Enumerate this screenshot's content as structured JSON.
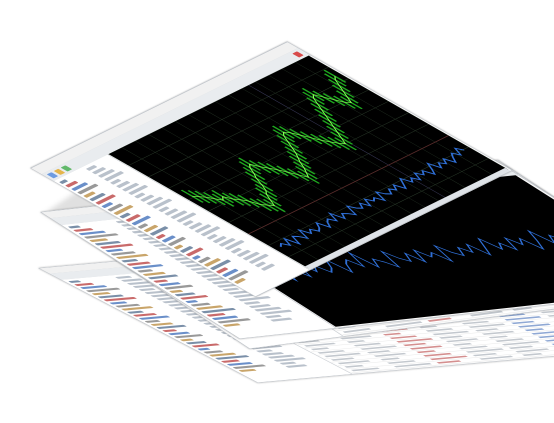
{
  "scene": {
    "description_text": "",
    "colors": {
      "chart_bg": "#000000",
      "grid": "#2a3a2a",
      "price_series": "#1faa1f",
      "price_highlight": "#8cff5a",
      "indicator_series": "#2f6fd6",
      "accent_red": "#d03030",
      "sheet_bg": "#fafafa",
      "toolbar_bg": "#e9ecef"
    },
    "icons": [
      "window-close-icon",
      "toolbar-icon",
      "chart-icon"
    ],
    "layers": [
      {
        "name": "chart-window",
        "content": "price-chart"
      },
      {
        "name": "terminal-window",
        "content": "data-grid"
      },
      {
        "name": "report-window",
        "content": "data-grid"
      },
      {
        "name": "journal-window",
        "content": "data-grid"
      }
    ]
  },
  "chart_data": {
    "type": "line",
    "title": "",
    "xlabel": "",
    "ylabel": "",
    "grid": true,
    "x": [
      0,
      1,
      2,
      3,
      4,
      5,
      6,
      7,
      8,
      9,
      10,
      11,
      12,
      13,
      14,
      15,
      16,
      17,
      18,
      19,
      20,
      21,
      22,
      23,
      24,
      25,
      26,
      27,
      28,
      29,
      30,
      31,
      32,
      33,
      34,
      35,
      36,
      37,
      38,
      39,
      40,
      41,
      42,
      43,
      44,
      45,
      46,
      47,
      48,
      49,
      50,
      51,
      52,
      53,
      54,
      55,
      56,
      57,
      58,
      59
    ],
    "series": [
      {
        "name": "",
        "values": [
          62,
          60,
          58,
          55,
          52,
          54,
          50,
          48,
          45,
          40,
          38,
          36,
          40,
          44,
          46,
          50,
          55,
          58,
          62,
          64,
          60,
          57,
          54,
          50,
          46,
          42,
          45,
          48,
          52,
          55,
          58,
          62,
          66,
          70,
          72,
          70,
          66,
          62,
          58,
          55,
          52,
          50,
          54,
          58,
          62,
          66,
          70,
          74,
          78,
          82,
          84,
          80,
          76,
          72,
          70,
          74,
          78,
          82,
          86,
          88
        ]
      },
      {
        "name": "",
        "values": [
          22,
          24,
          20,
          26,
          18,
          25,
          23,
          19,
          27,
          21,
          24,
          20,
          22,
          26,
          19,
          23,
          25,
          21,
          28,
          20,
          24,
          22,
          19,
          27,
          23,
          21,
          25,
          20,
          26,
          22,
          24,
          19,
          27,
          23,
          21,
          25,
          22,
          26,
          20,
          24,
          28,
          22,
          25,
          21,
          27,
          23,
          26,
          20,
          24,
          29,
          22,
          26,
          23,
          27,
          21,
          25,
          28,
          24,
          30,
          26
        ]
      }
    ],
    "ylim": [
      0,
      100
    ]
  }
}
